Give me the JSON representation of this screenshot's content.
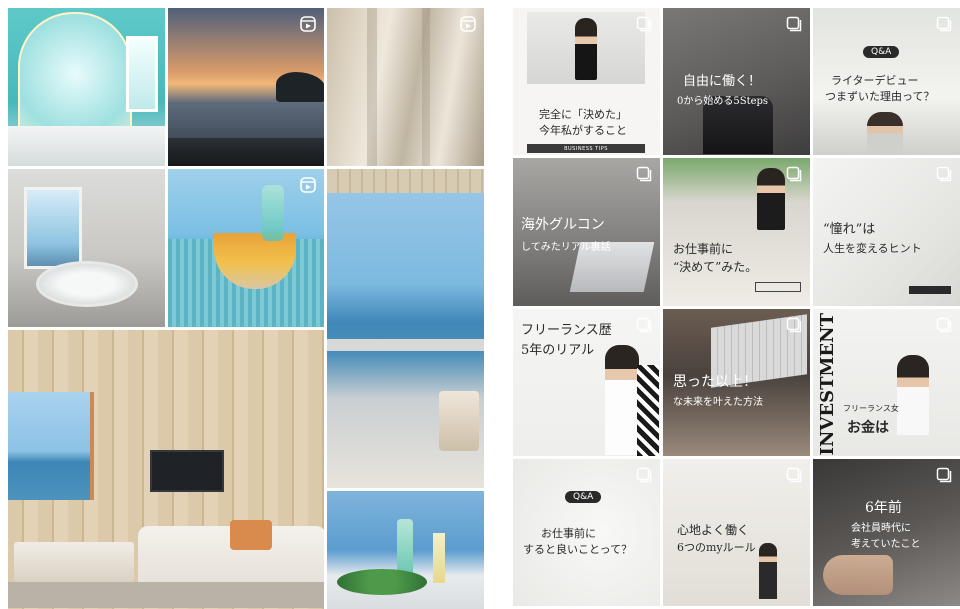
{
  "colors": {
    "background": "#ffffff",
    "badge": "#ffffff",
    "post_text": "#2a2a2a"
  },
  "left_grid": {
    "tiles": [
      {
        "id": "teal-bathroom-mirror",
        "badge": ""
      },
      {
        "id": "sunset-sea-rocks",
        "badge": "reel-icon"
      },
      {
        "id": "sheer-curtain-window",
        "badge": "reel-icon"
      },
      {
        "id": "bathroom-round-tub",
        "badge": ""
      },
      {
        "id": "fruit-bowl-poolside",
        "badge": "reel-icon"
      },
      {
        "id": "balcony-ocean-view",
        "badge": ""
      },
      {
        "id": "wood-room-sea-window",
        "badge": ""
      },
      {
        "id": "glass-flowers-sea",
        "badge": ""
      }
    ]
  },
  "right_grid": {
    "tiles": [
      {
        "lines": [
          "完全に「決めた」",
          "今年私がすること"
        ],
        "bar": "BUSINESS TIPS",
        "badge": "carousel-icon"
      },
      {
        "lines": [
          "自由に働く！",
          "0から始める5Steps"
        ],
        "badge": "carousel-icon"
      },
      {
        "pill": "Q&A",
        "lines": [
          "ライターデビュー",
          "つまずいた理由って？"
        ],
        "badge": "carousel-icon"
      },
      {
        "lines": [
          "海外グルコン",
          "してみたリアル裏話"
        ],
        "badge": "carousel-icon"
      },
      {
        "lines": [
          "お仕事前に",
          "“決めて”みた。"
        ],
        "badge": "carousel-icon"
      },
      {
        "lines": [
          "“憧れ”は",
          "人生を変えるヒント"
        ],
        "badge": "carousel-icon"
      },
      {
        "lines": [
          "フリーランス歴",
          "5年のリアル"
        ],
        "badge": "carousel-icon"
      },
      {
        "lines": [
          "思った以上！",
          "な未来を叶えた方法"
        ],
        "badge": "carousel-icon"
      },
      {
        "vertical": "INVESTMENT",
        "lines": [
          "フリーランス女",
          "お金は"
        ],
        "badge": "carousel-icon"
      },
      {
        "pill": "Q&A",
        "lines": [
          "お仕事前に",
          "すると良いことって？"
        ],
        "badge": "carousel-icon"
      },
      {
        "lines": [
          "心地よく働く",
          "6つのmyルール"
        ],
        "badge": "carousel-icon"
      },
      {
        "lines": [
          "6年前",
          "会社員時代に",
          "考えていたこと"
        ],
        "badge": "carousel-icon"
      }
    ]
  }
}
